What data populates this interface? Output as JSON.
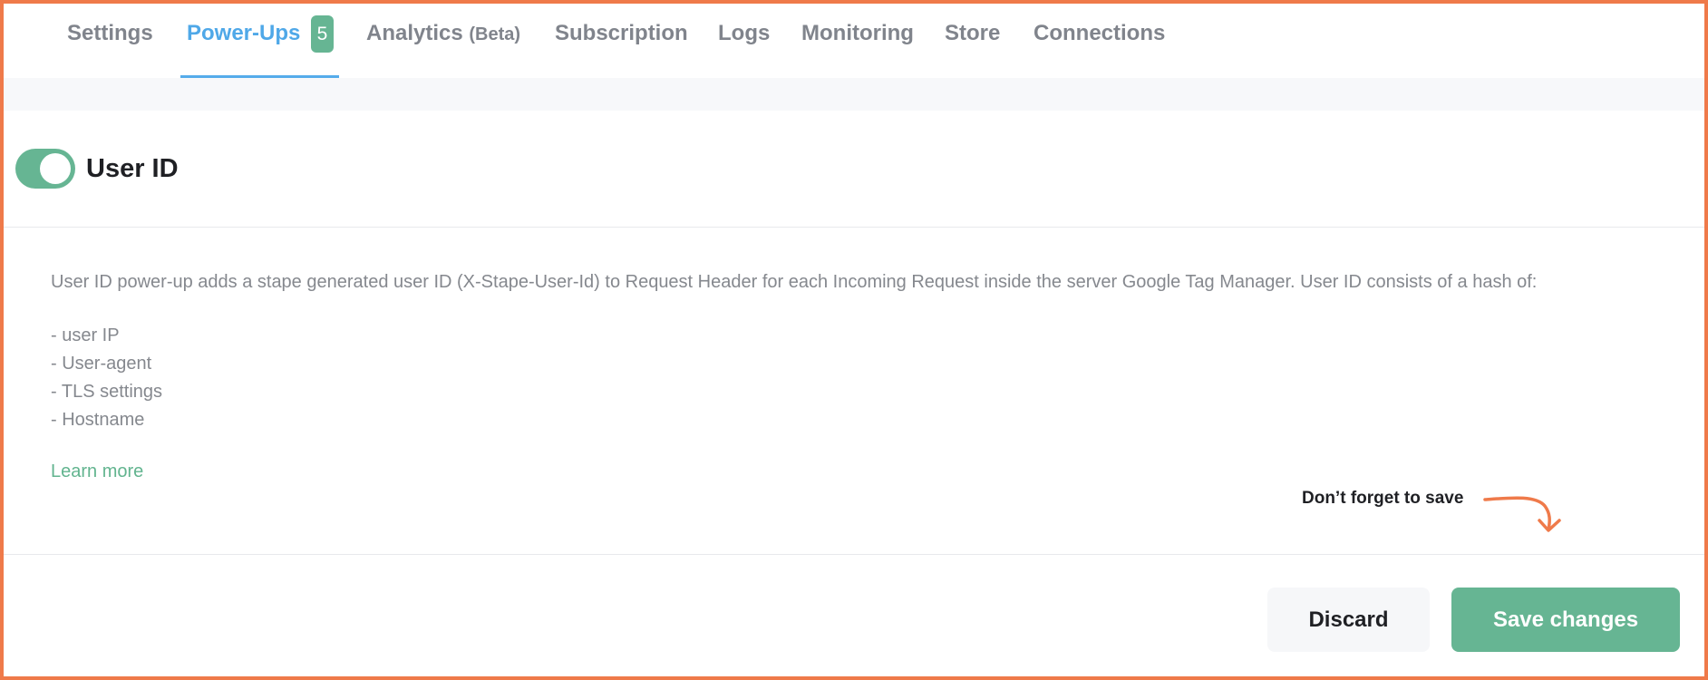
{
  "tabs": [
    {
      "label": "Settings",
      "active": false
    },
    {
      "label": "Power-Ups",
      "active": true,
      "badge": "5"
    },
    {
      "label": "Analytics",
      "suffix": "(Beta)",
      "active": false
    },
    {
      "label": "Subscription",
      "active": false
    },
    {
      "label": "Logs",
      "active": false
    },
    {
      "label": "Monitoring",
      "active": false
    },
    {
      "label": "Store",
      "active": false
    },
    {
      "label": "Connections",
      "active": false
    }
  ],
  "powerup": {
    "title": "User ID",
    "enabled": true,
    "description": "User ID power-up adds a stape generated user ID (X-Stape-User-Id) to Request Header for each Incoming Request inside the server Google Tag Manager. User ID consists of a hash of:",
    "hash_items": [
      "- user IP",
      "- User-agent",
      "- TLS settings",
      "- Hostname"
    ],
    "learn_more": "Learn more"
  },
  "footer": {
    "hint": "Don’t forget to save",
    "discard_label": "Discard",
    "save_label": "Save changes"
  },
  "colors": {
    "accent_green": "#66b593",
    "active_tab_blue": "#4fa8e8",
    "frame_orange": "#ef7a4a"
  }
}
